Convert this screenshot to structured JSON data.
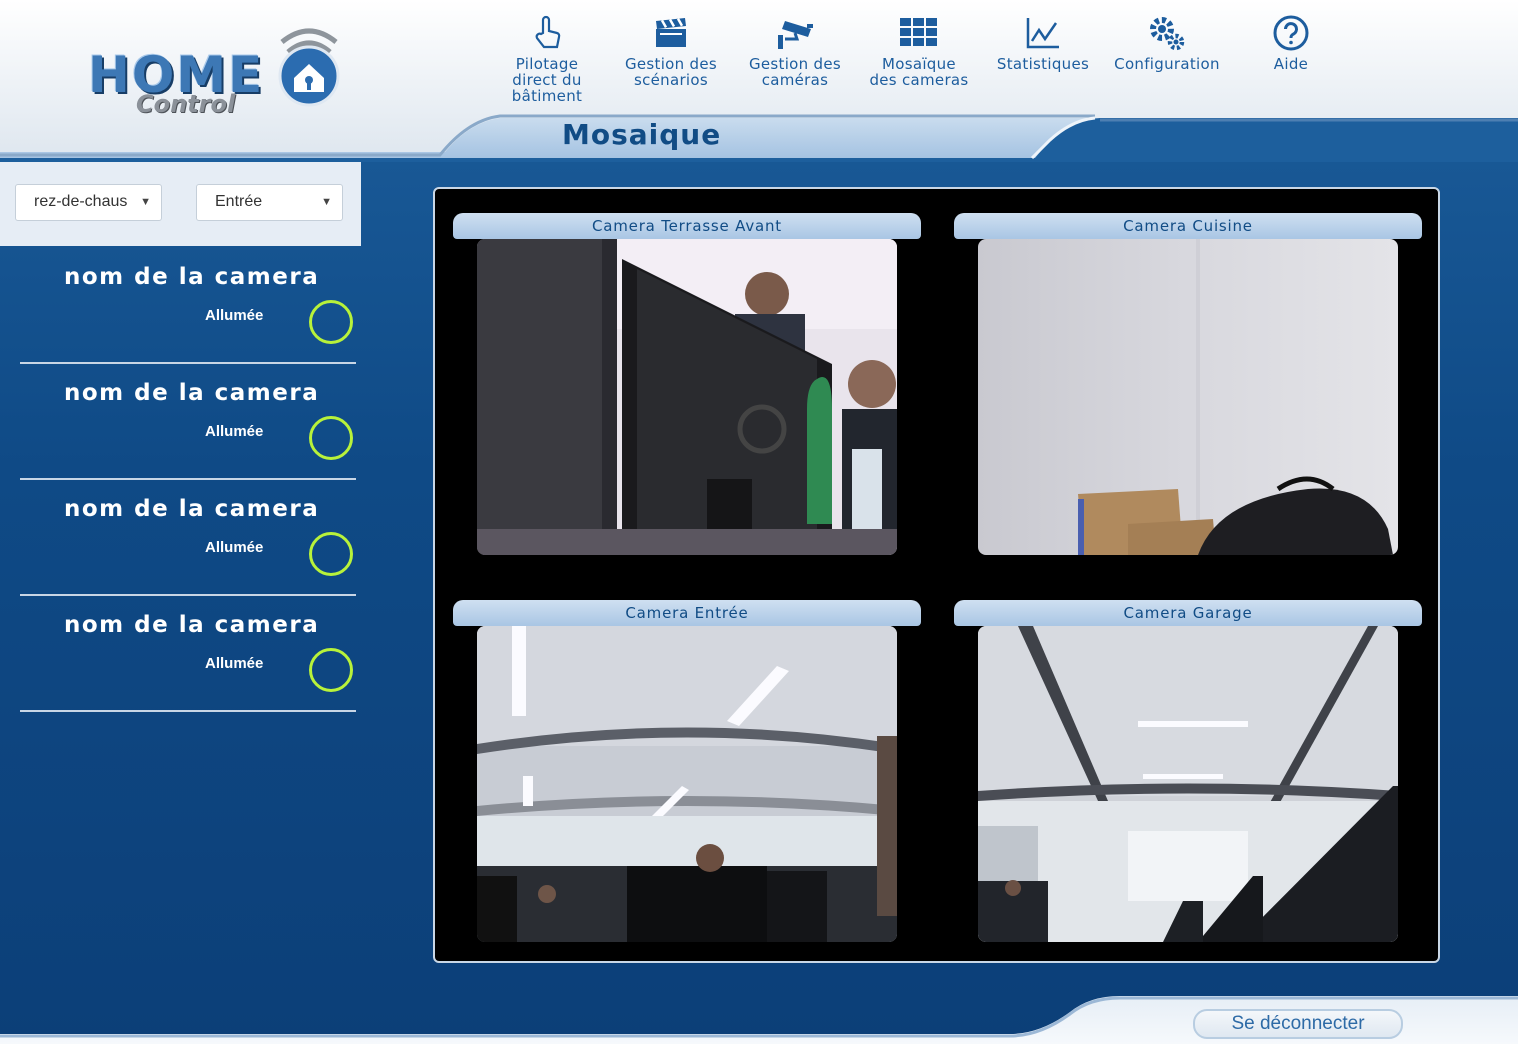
{
  "app": {
    "logo_main": "HOME",
    "logo_sub": "Control"
  },
  "nav": {
    "items": [
      {
        "label": "Pilotage\ndirect du\nbâtiment",
        "icon": "hand-pointer-icon"
      },
      {
        "label": "Gestion des\nscénarios",
        "icon": "clapperboard-icon"
      },
      {
        "label": "Gestion des\ncaméras",
        "icon": "security-camera-icon"
      },
      {
        "label": "Mosaïque\ndes cameras",
        "icon": "grid-icon"
      },
      {
        "label": "Statistiques",
        "icon": "line-chart-icon"
      },
      {
        "label": "Configuration",
        "icon": "gears-icon"
      },
      {
        "label": "Aide",
        "icon": "help-circle-icon"
      }
    ]
  },
  "page": {
    "title": "Mosaique"
  },
  "filters": {
    "floor": "rez-de-chaus",
    "room": "Entrée"
  },
  "camera_list": [
    {
      "name": "nom de la camera",
      "status": "Allumée"
    },
    {
      "name": "nom de la camera",
      "status": "Allumée"
    },
    {
      "name": "nom de la camera",
      "status": "Allumée"
    },
    {
      "name": "nom de la camera",
      "status": "Allumée"
    }
  ],
  "mosaic": [
    {
      "title": "Camera Terrasse Avant"
    },
    {
      "title": "Camera Cuisine"
    },
    {
      "title": "Camera Entrée"
    },
    {
      "title": "Camera Garage"
    }
  ],
  "footer": {
    "logout": "Se déconnecter"
  },
  "colors": {
    "accent": "#1d5d9e",
    "toggle_on": "#b8f23a",
    "background": "#0f4a86"
  }
}
